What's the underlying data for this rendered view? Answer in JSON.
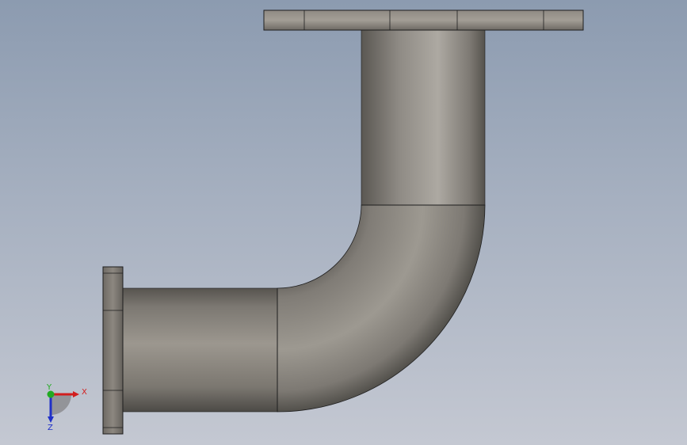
{
  "viewport": {
    "background_top": "#8c9bb0",
    "background_bottom": "#c4c8d2"
  },
  "model": {
    "name": "pipe-elbow-assembly",
    "parts": [
      "horizontal-flange",
      "vertical-flange",
      "horizontal-pipe",
      "vertical-pipe",
      "elbow-90"
    ],
    "colors": {
      "steel_light": "#a8a39c",
      "steel_mid": "#8d8882",
      "steel_dark": "#55524e",
      "edge": "#1e1e1e"
    }
  },
  "triad": {
    "x_label": "X",
    "y_label": "Y",
    "z_label": "Z",
    "x_color": "#d21e1e",
    "y_color": "#22aa22",
    "z_color": "#2030c8"
  }
}
